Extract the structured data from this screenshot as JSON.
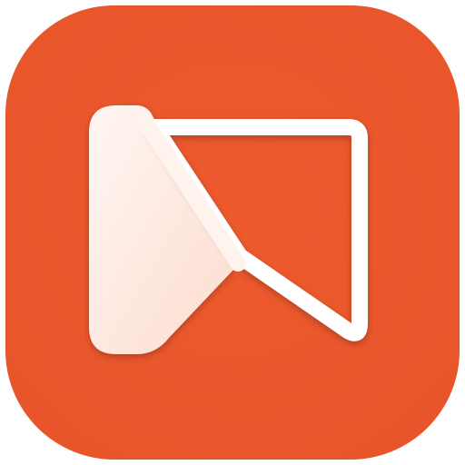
{
  "icon": {
    "name": "app-logo-icon",
    "colors": {
      "background": "#ED5A2E",
      "background_edge": "#E8552A",
      "glyph_fill_light": "#FFF6F2",
      "glyph_fill_mid": "#FCDCCF",
      "glyph_outline": "#FFFFFF"
    }
  }
}
